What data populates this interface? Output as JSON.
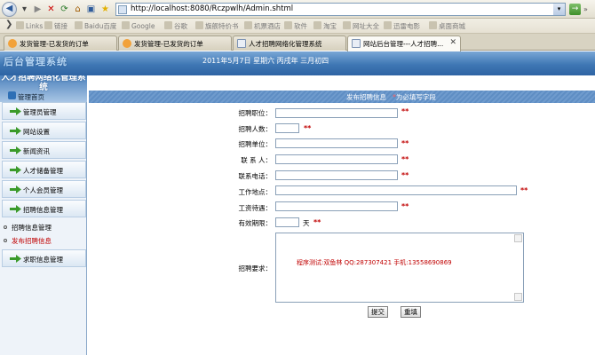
{
  "browser": {
    "url": "http://localhost:8080/Rczpwlh/Admin.shtml",
    "bookmarks": [
      "Links",
      "链接",
      "Baidu百度",
      "Google",
      "谷歌",
      "旗舰特价书",
      "机票酒店",
      "软件",
      "淘宝",
      "网址大全",
      "迅雷电影",
      "桌面商城"
    ],
    "tabs": [
      {
        "label": "发货管理-已发货的订单",
        "active": false
      },
      {
        "label": "发货管理-已发货的订单",
        "active": false
      },
      {
        "label": "人才招聘网络化管理系统",
        "active": false
      },
      {
        "label": "网站后台管理---人才招聘...",
        "active": true
      }
    ]
  },
  "header": {
    "logo": "后台管理系统",
    "date": "2011年5月7日 星期六 丙戌年 三月初四"
  },
  "sidebar": {
    "title": "人才招聘网络化管理系统",
    "home": "管理首页",
    "menu": [
      "管理员管理",
      "网站设置",
      "新闻资讯",
      "人才储备管理",
      "个人会员管理",
      "招聘信息管理"
    ],
    "submenu": [
      {
        "label": "招聘信息管理",
        "active": false
      },
      {
        "label": "发布招聘信息",
        "active": true
      }
    ],
    "menu_after": "求职信息管理"
  },
  "form": {
    "banner": "发布招聘信息",
    "banner_star": "*",
    "banner_note": "为必填写字段",
    "fields": [
      "招聘职位：",
      "招聘人数：",
      "招聘单位：",
      "联 系 人：",
      "联系电话：",
      "工作地点：",
      "工资待遇：",
      "有效期限："
    ],
    "required_mark": "**",
    "unit_day": "天",
    "requirement_label": "招聘要求：",
    "requirement_text": "程序测试:双鱼林 QQ:287307421 手机:13558690869",
    "submit": "提交",
    "reset": "重填"
  }
}
